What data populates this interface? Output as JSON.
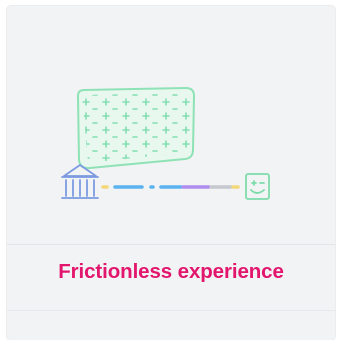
{
  "card": {
    "title": "Frictionless experience",
    "title_color": "#e3166d"
  },
  "illustration": {
    "icons": [
      "bank-icon",
      "smiley-face-icon",
      "grid-card-icon"
    ],
    "colors": {
      "outline_green": "#86e0b0",
      "bank_blue": "#6b8fd6",
      "face_green": "#7edcaa",
      "line_yellow": "#f3d87a",
      "line_blue": "#5ab3f0",
      "line_purple": "#b08cf0",
      "line_gray": "#c5c8ce"
    }
  }
}
